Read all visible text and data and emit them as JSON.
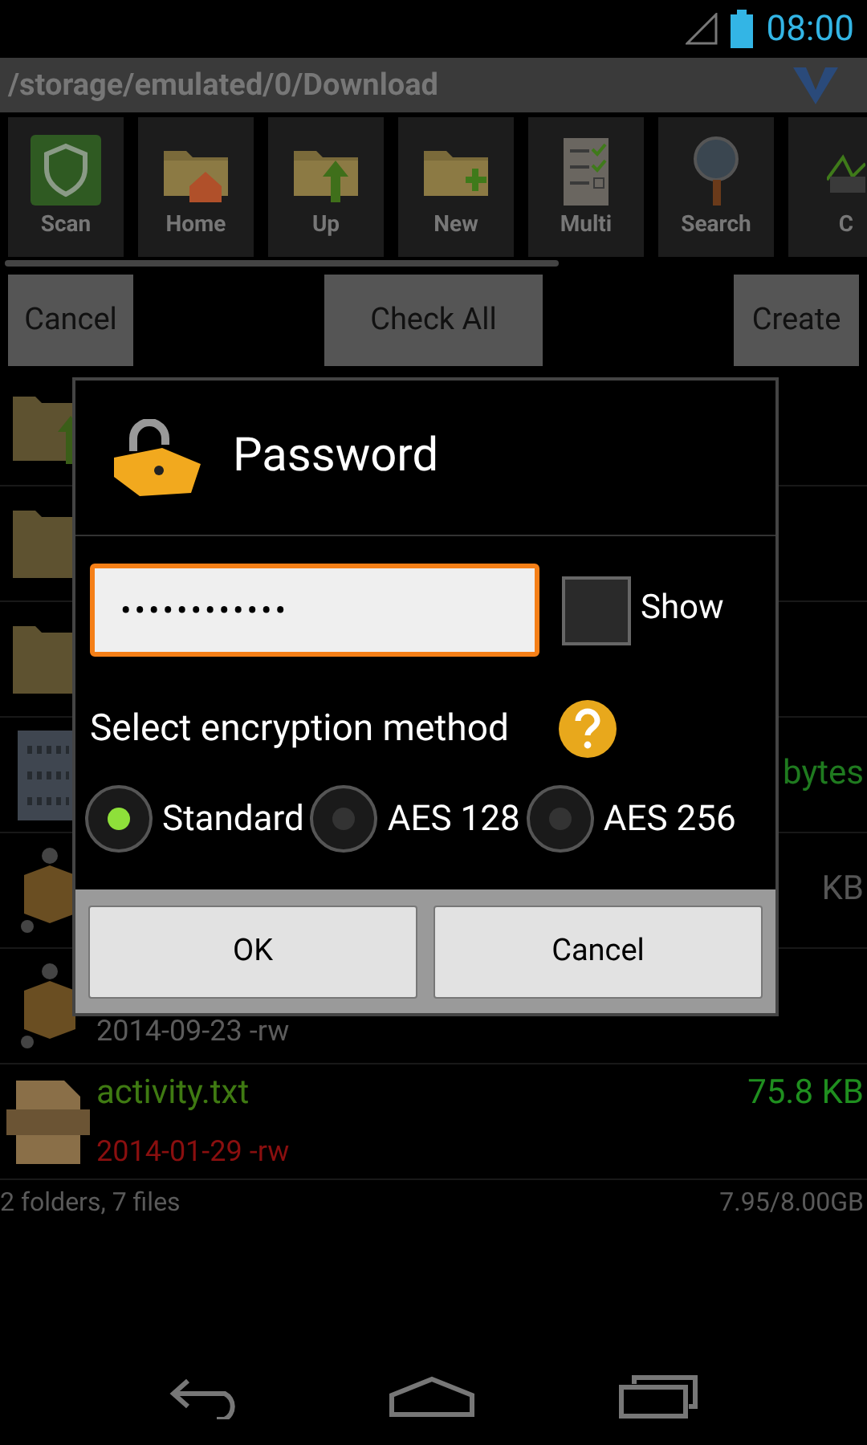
{
  "status_bar": {
    "time": "08:00"
  },
  "path_bar": {
    "path": "/storage/emulated/0/Download"
  },
  "toolbar": [
    {
      "kind": "scan",
      "label": "Scan"
    },
    {
      "kind": "home",
      "label": "Home"
    },
    {
      "kind": "up",
      "label": "Up"
    },
    {
      "kind": "new",
      "label": "New"
    },
    {
      "kind": "multi",
      "label": "Multi"
    },
    {
      "kind": "search",
      "label": "Search"
    },
    {
      "kind": "cpu",
      "label": "C"
    }
  ],
  "action_buttons": [
    "Cancel",
    "Check All",
    "Create"
  ],
  "files": [
    {
      "kind": "folder-up"
    },
    {
      "kind": "folder"
    },
    {
      "kind": "folder"
    },
    {
      "kind": "binary",
      "size": {
        "text": "bytes",
        "color": "#1f7a1f"
      }
    },
    {
      "kind": "archive",
      "size": {
        "text": "KB",
        "color": "#555555"
      }
    },
    {
      "kind": "archive",
      "date": {
        "text": "2014-09-23 -rw",
        "color": "#5c5c5c"
      }
    },
    {
      "kind": "text",
      "name": "activity.txt",
      "color": "#3f7a12",
      "size": {
        "text": "75.8 KB",
        "color": "#1f8f1f"
      },
      "date": {
        "text": "2014-01-29 -rw",
        "color": "#8a0f0f"
      }
    }
  ],
  "footer": {
    "counts": "2 folders, 7 files",
    "storage": "7.95/8.00GB"
  },
  "dialog": {
    "title": "Password",
    "password": "••••••••••••",
    "show": {
      "label": "Show",
      "checked": false
    },
    "method_label": "Select encryption method",
    "methods": [
      {
        "label": "Standard",
        "selected": true
      },
      {
        "label": "AES 128",
        "selected": false
      },
      {
        "label": "AES 256",
        "selected": false
      }
    ],
    "buttons": [
      "OK",
      "Cancel"
    ]
  }
}
